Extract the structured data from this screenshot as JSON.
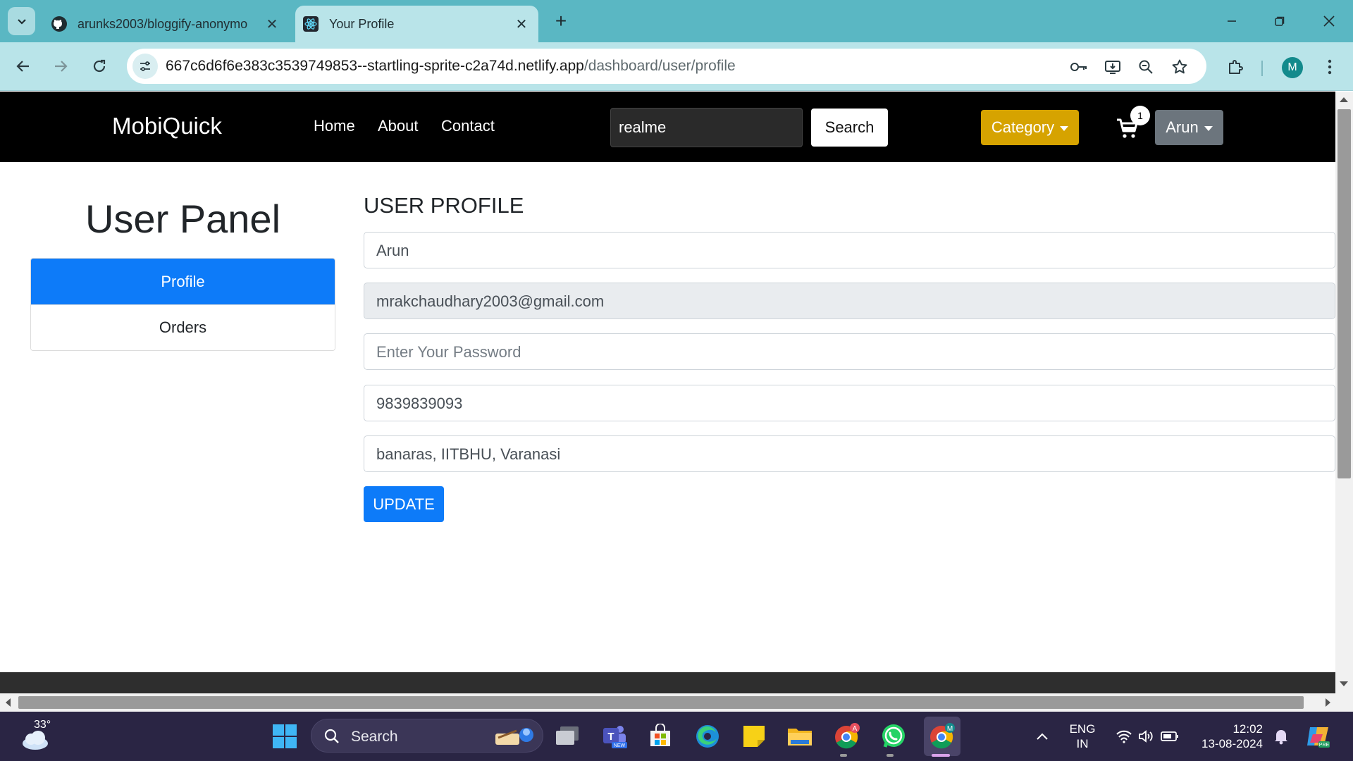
{
  "browser": {
    "tabs": [
      {
        "title": "arunks2003/bloggify-anonymo",
        "favicon": "github-icon",
        "active": false
      },
      {
        "title": "Your Profile",
        "favicon": "react-icon",
        "active": true
      }
    ],
    "url_host": "667c6d6f6e383c3539749853--startling-sprite-c2a74d.netlify.app",
    "url_path": "/dashboard/user/profile",
    "profile_initial": "M"
  },
  "site": {
    "brand": "MobiQuick",
    "nav_links": [
      "Home",
      "About",
      "Contact"
    ],
    "search_value": "realme",
    "search_button": "Search",
    "category_label": "Category",
    "cart_count": "1",
    "user_label": "Arun"
  },
  "panel": {
    "title": "User Panel",
    "items": [
      {
        "label": "Profile",
        "active": true
      },
      {
        "label": "Orders",
        "active": false
      }
    ]
  },
  "profile": {
    "title": "USER PROFILE",
    "name": "Arun",
    "email": "mrakchaudhary2003@gmail.com",
    "password_placeholder": "Enter Your Password",
    "phone": "9839839093",
    "address": "banaras, IITBHU, Varanasi",
    "update_button": "UPDATE"
  },
  "taskbar": {
    "temperature": "33°",
    "search_label": "Search",
    "lang_top": "ENG",
    "lang_bottom": "IN",
    "time": "12:02",
    "date": "13-08-2024"
  },
  "colors": {
    "primary": "#0d7bf9",
    "warning": "#d6a300",
    "secondary": "#6c757d",
    "navbar": "#000000",
    "chrome": "#5ab7c3"
  }
}
